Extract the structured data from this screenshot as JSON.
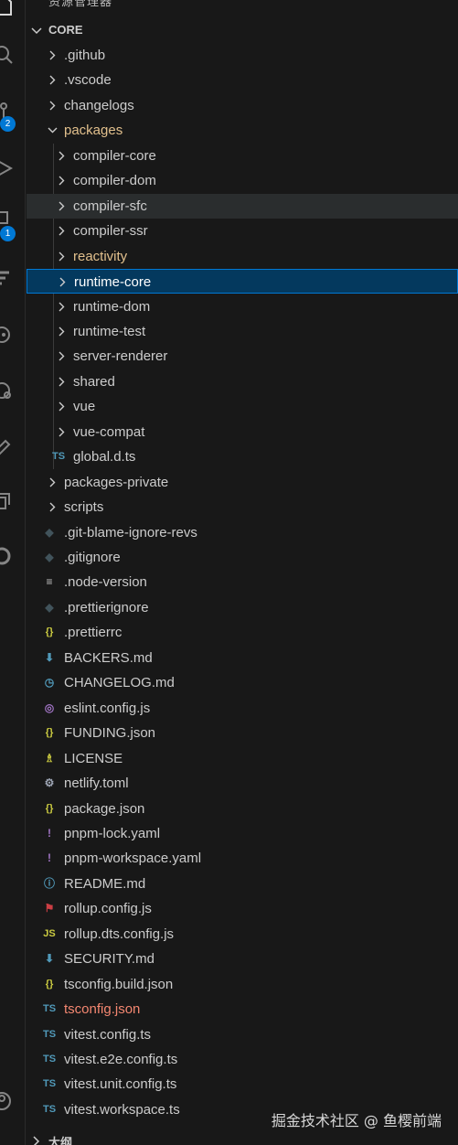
{
  "explorer": {
    "top_title": "资源管理器",
    "section_title": "CORE",
    "bottom_section_title": "大纲",
    "watermark": "掘金技术社区 @ 鱼樱前端"
  },
  "activity_badges": {
    "source_control": "2",
    "extensions": "1"
  },
  "tree": [
    {
      "label": "github",
      "prefix": ".",
      "type": "folder",
      "expanded": false,
      "depth": 1,
      "icon": "chevron-right"
    },
    {
      "label": ".vscode",
      "type": "folder",
      "expanded": false,
      "depth": 1
    },
    {
      "label": "changelogs",
      "type": "folder",
      "expanded": false,
      "depth": 1
    },
    {
      "label": "packages",
      "type": "folder",
      "expanded": true,
      "depth": 1,
      "color": "#e2c08d"
    },
    {
      "label": "compiler-core",
      "type": "folder",
      "depth": 2
    },
    {
      "label": "compiler-dom",
      "type": "folder",
      "depth": 2
    },
    {
      "label": "compiler-sfc",
      "type": "folder",
      "depth": 2,
      "state": "hover"
    },
    {
      "label": "compiler-ssr",
      "type": "folder",
      "depth": 2
    },
    {
      "label": "reactivity",
      "type": "folder",
      "depth": 2,
      "color": "#e2c08d"
    },
    {
      "label": "runtime-core",
      "type": "folder",
      "depth": 2,
      "state": "selected",
      "color": "#ffffff"
    },
    {
      "label": "runtime-dom",
      "type": "folder",
      "depth": 2
    },
    {
      "label": "runtime-test",
      "type": "folder",
      "depth": 2
    },
    {
      "label": "server-renderer",
      "type": "folder",
      "depth": 2
    },
    {
      "label": "shared",
      "type": "folder",
      "depth": 2
    },
    {
      "label": "vue",
      "type": "folder",
      "depth": 2
    },
    {
      "label": "vue-compat",
      "type": "folder",
      "depth": 2
    },
    {
      "label": "global.d.ts",
      "type": "file",
      "depth": 2,
      "icon": "typescript-icon",
      "icon_text": "TS",
      "icon_color": "#519aba"
    },
    {
      "label": "packages-private",
      "type": "folder",
      "depth": 1
    },
    {
      "label": "scripts",
      "type": "folder",
      "depth": 1
    },
    {
      "label": ".git-blame-ignore-revs",
      "type": "file",
      "depth": 1,
      "icon": "git-icon",
      "icon_text": "◆",
      "icon_color": "#41535b"
    },
    {
      "label": ".gitignore",
      "type": "file",
      "depth": 1,
      "icon": "git-icon",
      "icon_text": "◆",
      "icon_color": "#41535b"
    },
    {
      "label": ".node-version",
      "type": "file",
      "depth": 1,
      "icon": "text-lines-icon",
      "icon_text": "≡",
      "icon_color": "#c5c5c5"
    },
    {
      "label": ".prettierignore",
      "type": "file",
      "depth": 1,
      "icon": "prettier-icon",
      "icon_text": "◆",
      "icon_color": "#41535b"
    },
    {
      "label": ".prettierrc",
      "type": "file",
      "depth": 1,
      "icon": "json-icon",
      "icon_text": "{}",
      "icon_color": "#cbcb41"
    },
    {
      "label": "BACKERS.md",
      "type": "file",
      "depth": 1,
      "icon": "markdown-icon",
      "icon_text": "⬇",
      "icon_color": "#519aba"
    },
    {
      "label": "CHANGELOG.md",
      "type": "file",
      "depth": 1,
      "icon": "clock-icon",
      "icon_text": "◷",
      "icon_color": "#519aba"
    },
    {
      "label": "eslint.config.js",
      "type": "file",
      "depth": 1,
      "icon": "eslint-icon",
      "icon_text": "◎",
      "icon_color": "#a074c4"
    },
    {
      "label": "FUNDING.json",
      "type": "file",
      "depth": 1,
      "icon": "json-icon",
      "icon_text": "{}",
      "icon_color": "#cbcb41"
    },
    {
      "label": "LICENSE",
      "type": "file",
      "depth": 1,
      "icon": "license-icon",
      "icon_text": "♗",
      "icon_color": "#cbcb41"
    },
    {
      "label": "netlify.toml",
      "type": "file",
      "depth": 1,
      "icon": "gear-icon",
      "icon_text": "⚙",
      "icon_color": "#9da5b4"
    },
    {
      "label": "package.json",
      "type": "file",
      "depth": 1,
      "icon": "json-icon",
      "icon_text": "{}",
      "icon_color": "#cbcb41"
    },
    {
      "label": "pnpm-lock.yaml",
      "type": "file",
      "depth": 1,
      "icon": "yaml-icon",
      "icon_text": "!",
      "icon_color": "#a074c4"
    },
    {
      "label": "pnpm-workspace.yaml",
      "type": "file",
      "depth": 1,
      "icon": "yaml-icon",
      "icon_text": "!",
      "icon_color": "#a074c4"
    },
    {
      "label": "README.md",
      "type": "file",
      "depth": 1,
      "icon": "info-icon",
      "icon_text": "ⓘ",
      "icon_color": "#519aba"
    },
    {
      "label": "rollup.config.js",
      "type": "file",
      "depth": 1,
      "icon": "rollup-icon",
      "icon_text": "⚑",
      "icon_color": "#cc3e44"
    },
    {
      "label": "rollup.dts.config.js",
      "type": "file",
      "depth": 1,
      "icon": "javascript-icon",
      "icon_text": "JS",
      "icon_color": "#cbcb41"
    },
    {
      "label": "SECURITY.md",
      "type": "file",
      "depth": 1,
      "icon": "markdown-icon",
      "icon_text": "⬇",
      "icon_color": "#519aba"
    },
    {
      "label": "tsconfig.build.json",
      "type": "file",
      "depth": 1,
      "icon": "json-icon",
      "icon_text": "{}",
      "icon_color": "#cbcb41"
    },
    {
      "label": "tsconfig.json",
      "type": "file",
      "depth": 1,
      "icon": "tsconfig-icon",
      "icon_text": "TS",
      "icon_color": "#519aba",
      "color": "#f48771"
    },
    {
      "label": "vitest.config.ts",
      "type": "file",
      "depth": 1,
      "icon": "typescript-icon",
      "icon_text": "TS",
      "icon_color": "#519aba"
    },
    {
      "label": "vitest.e2e.config.ts",
      "type": "file",
      "depth": 1,
      "icon": "typescript-icon",
      "icon_text": "TS",
      "icon_color": "#519aba"
    },
    {
      "label": "vitest.unit.config.ts",
      "type": "file",
      "depth": 1,
      "icon": "typescript-icon",
      "icon_text": "TS",
      "icon_color": "#519aba"
    },
    {
      "label": "vitest.workspace.ts",
      "type": "file",
      "depth": 1,
      "icon": "typescript-icon",
      "icon_text": "TS",
      "icon_color": "#519aba"
    }
  ]
}
